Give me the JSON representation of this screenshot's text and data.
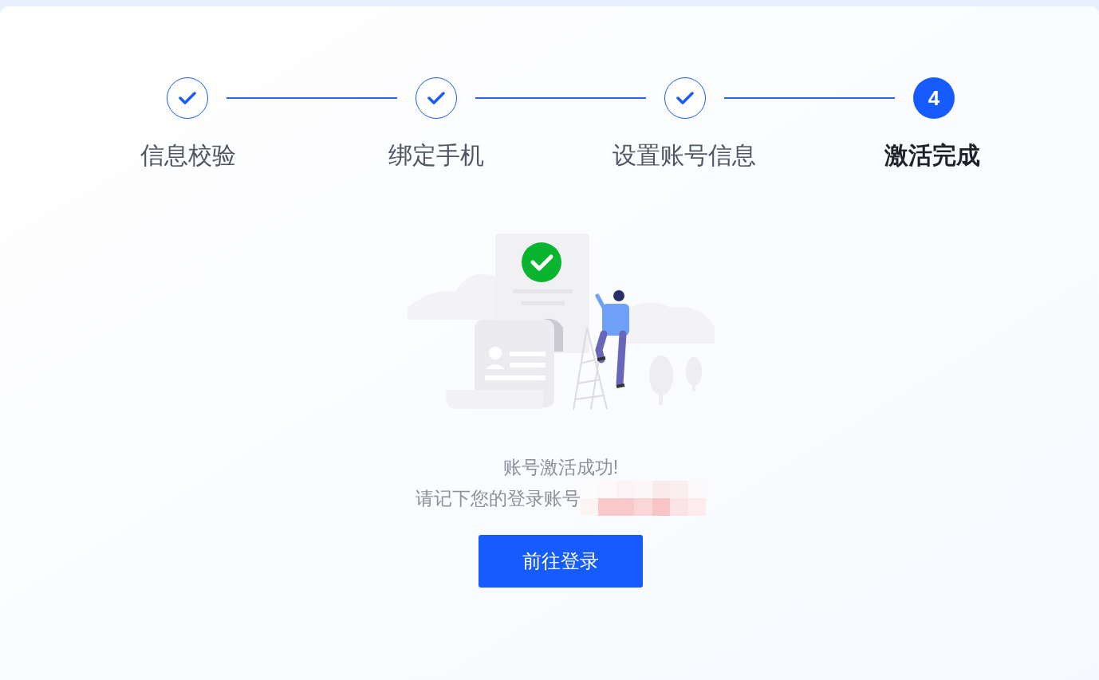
{
  "steps": [
    {
      "label": "信息校验",
      "completed": true,
      "selected": false
    },
    {
      "label": "绑定手机",
      "completed": true,
      "selected": false
    },
    {
      "label": "设置账号信息",
      "completed": true,
      "selected": false
    },
    {
      "label": "激活完成",
      "completed": false,
      "selected": true,
      "number": "4"
    }
  ],
  "result": {
    "title": "账号激活成功!",
    "account_prompt": "请记下您的登录账号",
    "account_redacted": true
  },
  "button": "前往登录"
}
